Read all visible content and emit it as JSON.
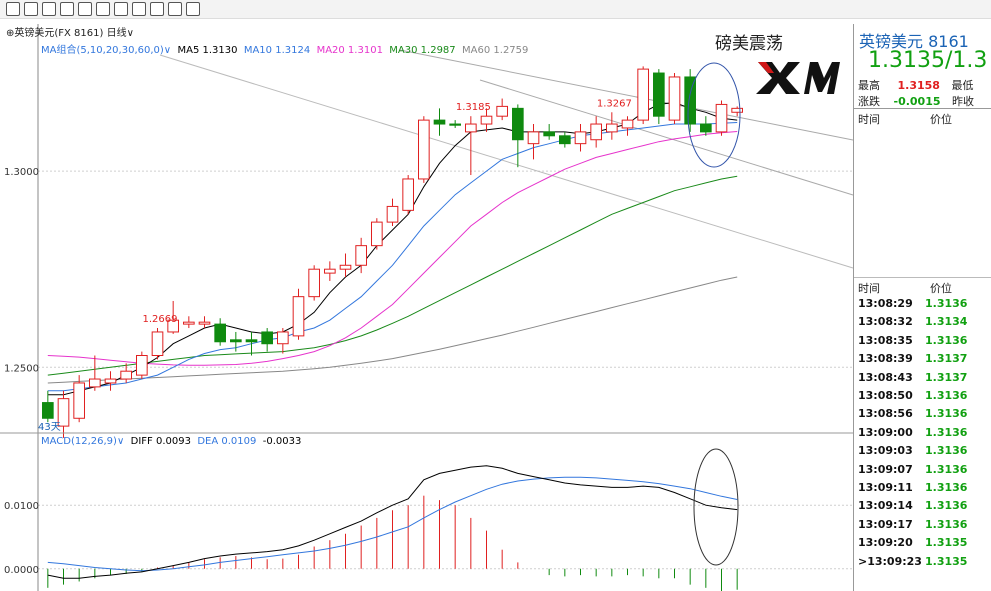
{
  "header": {
    "symbol_line": "⊕英镑美元(FX 8161)  日线∨",
    "title": "磅美震荡",
    "logo_text": "XM"
  },
  "indicators": {
    "ma_label": "MA组合(5,10,20,30,60,0)∨",
    "ma5": "MA5 1.3130",
    "ma10": "MA10 1.3124",
    "ma20": "MA20 1.3101",
    "ma30": "MA30 1.2987",
    "ma60": "MA60 1.2759",
    "macd_label": "MACD(12,26,9)∨",
    "diff": "DIFF 0.0093",
    "dea": "DEA 0.0109",
    "macd_val": "-0.0033"
  },
  "colors": {
    "up": "#e02020",
    "down": "#0f8a0f",
    "ma5": "#000000",
    "ma10": "#3377dd",
    "ma20": "#e633cc",
    "ma30": "#1a8a1a",
    "ma60": "#888888",
    "diff": "#000000",
    "dea": "#3377dd",
    "annotation": "#3355aa",
    "channel": "#aaaaaa"
  },
  "quote_panel": {
    "name": "英镑美元  8161",
    "price": "1.3135/1.3",
    "high_label": "最高",
    "high_value": "1.3158",
    "low_label": "最低",
    "change_label": "涨跌",
    "change_value": "-0.0015",
    "prev_label": "昨收",
    "time_header": "时间",
    "price_header": "价位",
    "time_header2": "时间",
    "price_header2": "价位",
    "ticks": [
      {
        "time": "13:08:29",
        "price": "1.3136"
      },
      {
        "time": "13:08:32",
        "price": "1.3134"
      },
      {
        "time": "13:08:35",
        "price": "1.3136"
      },
      {
        "time": "13:08:39",
        "price": "1.3137"
      },
      {
        "time": "13:08:43",
        "price": "1.3137"
      },
      {
        "time": "13:08:50",
        "price": "1.3136"
      },
      {
        "time": "13:08:56",
        "price": "1.3136"
      },
      {
        "time": "13:09:00",
        "price": "1.3136"
      },
      {
        "time": "13:09:03",
        "price": "1.3136"
      },
      {
        "time": "13:09:07",
        "price": "1.3136"
      },
      {
        "time": "13:09:11",
        "price": "1.3136"
      },
      {
        "time": "13:09:14",
        "price": "1.3136"
      },
      {
        "time": "13:09:17",
        "price": "1.3136"
      },
      {
        "time": "13:09:20",
        "price": "1.3135"
      },
      {
        "time": ">13:09:23",
        "price": "1.3135"
      }
    ]
  },
  "chart_data": {
    "type": "candlestick",
    "price_axis": {
      "ylim": [
        1.2335,
        1.3375
      ],
      "ticks": [
        1.25,
        1.3
      ],
      "tick_labels": [
        "1.2500",
        "1.3000"
      ]
    },
    "macd_axis": {
      "ylim": [
        -0.0035,
        0.019
      ],
      "ticks": [
        0.0,
        0.01
      ],
      "tick_labels": [
        "0.0000",
        "0.0100"
      ]
    },
    "annotations": [
      {
        "label": "1.2669",
        "index": 7,
        "price": 1.2669
      },
      {
        "label": "1.3185",
        "index": 27,
        "price": 1.3185
      },
      {
        "label": "1.3267",
        "index": 36,
        "price": 1.3267
      }
    ],
    "period_label": "43天",
    "candles": [
      {
        "o": 1.241,
        "h": 1.244,
        "l": 1.236,
        "c": 1.237
      },
      {
        "o": 1.235,
        "h": 1.244,
        "l": 1.232,
        "c": 1.242
      },
      {
        "o": 1.237,
        "h": 1.248,
        "l": 1.236,
        "c": 1.246
      },
      {
        "o": 1.245,
        "h": 1.253,
        "l": 1.244,
        "c": 1.247
      },
      {
        "o": 1.246,
        "h": 1.249,
        "l": 1.244,
        "c": 1.247
      },
      {
        "o": 1.247,
        "h": 1.251,
        "l": 1.246,
        "c": 1.249
      },
      {
        "o": 1.248,
        "h": 1.254,
        "l": 1.247,
        "c": 1.253
      },
      {
        "o": 1.253,
        "h": 1.26,
        "l": 1.252,
        "c": 1.259
      },
      {
        "o": 1.259,
        "h": 1.2669,
        "l": 1.2585,
        "c": 1.262
      },
      {
        "o": 1.261,
        "h": 1.263,
        "l": 1.26,
        "c": 1.2615
      },
      {
        "o": 1.261,
        "h": 1.263,
        "l": 1.26,
        "c": 1.2615
      },
      {
        "o": 1.261,
        "h": 1.2625,
        "l": 1.2555,
        "c": 1.2565
      },
      {
        "o": 1.257,
        "h": 1.259,
        "l": 1.254,
        "c": 1.2565
      },
      {
        "o": 1.257,
        "h": 1.259,
        "l": 1.253,
        "c": 1.2565
      },
      {
        "o": 1.259,
        "h": 1.26,
        "l": 1.254,
        "c": 1.256
      },
      {
        "o": 1.256,
        "h": 1.26,
        "l": 1.2535,
        "c": 1.259
      },
      {
        "o": 1.258,
        "h": 1.27,
        "l": 1.257,
        "c": 1.268
      },
      {
        "o": 1.268,
        "h": 1.276,
        "l": 1.267,
        "c": 1.275
      },
      {
        "o": 1.274,
        "h": 1.277,
        "l": 1.272,
        "c": 1.275
      },
      {
        "o": 1.275,
        "h": 1.279,
        "l": 1.273,
        "c": 1.276
      },
      {
        "o": 1.276,
        "h": 1.283,
        "l": 1.274,
        "c": 1.281
      },
      {
        "o": 1.281,
        "h": 1.288,
        "l": 1.28,
        "c": 1.287
      },
      {
        "o": 1.287,
        "h": 1.293,
        "l": 1.286,
        "c": 1.291
      },
      {
        "o": 1.29,
        "h": 1.299,
        "l": 1.289,
        "c": 1.298
      },
      {
        "o": 1.298,
        "h": 1.314,
        "l": 1.297,
        "c": 1.313
      },
      {
        "o": 1.313,
        "h": 1.316,
        "l": 1.309,
        "c": 1.312
      },
      {
        "o": 1.312,
        "h": 1.313,
        "l": 1.311,
        "c": 1.3117
      },
      {
        "o": 1.31,
        "h": 1.314,
        "l": 1.299,
        "c": 1.312
      },
      {
        "o": 1.312,
        "h": 1.316,
        "l": 1.31,
        "c": 1.314
      },
      {
        "o": 1.314,
        "h": 1.3185,
        "l": 1.313,
        "c": 1.3165
      },
      {
        "o": 1.316,
        "h": 1.317,
        "l": 1.301,
        "c": 1.308
      },
      {
        "o": 1.307,
        "h": 1.312,
        "l": 1.303,
        "c": 1.31
      },
      {
        "o": 1.31,
        "h": 1.312,
        "l": 1.308,
        "c": 1.309
      },
      {
        "o": 1.309,
        "h": 1.31,
        "l": 1.306,
        "c": 1.307
      },
      {
        "o": 1.307,
        "h": 1.312,
        "l": 1.305,
        "c": 1.31
      },
      {
        "o": 1.308,
        "h": 1.314,
        "l": 1.306,
        "c": 1.312
      },
      {
        "o": 1.31,
        "h": 1.315,
        "l": 1.308,
        "c": 1.312
      },
      {
        "o": 1.311,
        "h": 1.314,
        "l": 1.309,
        "c": 1.313
      },
      {
        "o": 1.313,
        "h": 1.3267,
        "l": 1.312,
        "c": 1.326
      },
      {
        "o": 1.325,
        "h": 1.326,
        "l": 1.312,
        "c": 1.314
      },
      {
        "o": 1.313,
        "h": 1.325,
        "l": 1.312,
        "c": 1.324
      },
      {
        "o": 1.324,
        "h": 1.326,
        "l": 1.31,
        "c": 1.312
      },
      {
        "o": 1.312,
        "h": 1.314,
        "l": 1.309,
        "c": 1.31
      },
      {
        "o": 1.31,
        "h": 1.318,
        "l": 1.309,
        "c": 1.317
      },
      {
        "o": 1.315,
        "h": 1.3165,
        "l": 1.314,
        "c": 1.316
      }
    ],
    "ma5": [
      1.243,
      1.243,
      1.244,
      1.245,
      1.246,
      1.248,
      1.25,
      1.2525,
      1.256,
      1.258,
      1.26,
      1.261,
      1.26,
      1.259,
      1.2585,
      1.259,
      1.261,
      1.264,
      1.269,
      1.273,
      1.276,
      1.281,
      1.285,
      1.289,
      1.296,
      1.302,
      1.3065,
      1.31,
      1.3105,
      1.311,
      1.31,
      1.31,
      1.31,
      1.31,
      1.3095,
      1.31,
      1.311,
      1.312,
      1.315,
      1.317,
      1.3175,
      1.316,
      1.315,
      1.3135,
      1.313
    ],
    "ma10": [
      1.244,
      1.244,
      1.2445,
      1.245,
      1.2455,
      1.246,
      1.247,
      1.248,
      1.25,
      1.252,
      1.2535,
      1.2545,
      1.255,
      1.256,
      1.257,
      1.2575,
      1.259,
      1.26,
      1.262,
      1.265,
      1.268,
      1.272,
      1.276,
      1.281,
      1.286,
      1.29,
      1.294,
      1.297,
      1.3,
      1.303,
      1.3045,
      1.306,
      1.307,
      1.308,
      1.309,
      1.3095,
      1.31,
      1.3105,
      1.311,
      1.3115,
      1.312,
      1.312,
      1.312,
      1.3122,
      1.3124
    ],
    "ma20": [
      1.253,
      1.2528,
      1.2526,
      1.2522,
      1.2518,
      1.2514,
      1.251,
      1.2508,
      1.2506,
      1.2505,
      1.2505,
      1.2506,
      1.2507,
      1.251,
      1.2515,
      1.2522,
      1.253,
      1.254,
      1.2555,
      1.2575,
      1.26,
      1.263,
      1.266,
      1.27,
      1.274,
      1.278,
      1.282,
      1.286,
      1.289,
      1.292,
      1.2945,
      1.2965,
      1.2985,
      1.3005,
      1.302,
      1.3035,
      1.3045,
      1.3055,
      1.3065,
      1.3075,
      1.3082,
      1.3088,
      1.3094,
      1.3098,
      1.3101
    ],
    "ma30": [
      1.248,
      1.2485,
      1.249,
      1.2495,
      1.25,
      1.2505,
      1.251,
      1.2515,
      1.252,
      1.2525,
      1.253,
      1.2532,
      1.2534,
      1.2536,
      1.2538,
      1.254,
      1.2545,
      1.255,
      1.2558,
      1.2568,
      1.258,
      1.2595,
      1.2612,
      1.263,
      1.265,
      1.267,
      1.269,
      1.271,
      1.273,
      1.275,
      1.277,
      1.279,
      1.281,
      1.283,
      1.285,
      1.287,
      1.289,
      1.2905,
      1.292,
      1.2935,
      1.295,
      1.296,
      1.297,
      1.298,
      1.2987
    ],
    "ma60": [
      1.246,
      1.2462,
      1.2464,
      1.2466,
      1.2468,
      1.247,
      1.2472,
      1.2474,
      1.2476,
      1.2478,
      1.248,
      1.2482,
      1.2484,
      1.2486,
      1.2488,
      1.249,
      1.2493,
      1.2496,
      1.25,
      1.2505,
      1.251,
      1.2516,
      1.2522,
      1.253,
      1.2538,
      1.2546,
      1.2555,
      1.2564,
      1.2573,
      1.2582,
      1.2592,
      1.2602,
      1.2612,
      1.2622,
      1.2632,
      1.2642,
      1.2652,
      1.2662,
      1.2672,
      1.2682,
      1.2692,
      1.2702,
      1.2712,
      1.2722,
      1.273
    ],
    "macd_hist": [
      -0.003,
      -0.0025,
      -0.002,
      -0.0015,
      -0.001,
      -0.0008,
      -0.0005,
      0.0002,
      0.0005,
      0.001,
      0.0015,
      0.0018,
      0.002,
      0.0018,
      0.0015,
      0.0016,
      0.0022,
      0.0035,
      0.0045,
      0.0055,
      0.0068,
      0.008,
      0.0092,
      0.01,
      0.0115,
      0.0108,
      0.01,
      0.008,
      0.006,
      0.003,
      0.001,
      0.0,
      -0.001,
      -0.0012,
      -0.001,
      -0.0012,
      -0.0012,
      -0.001,
      -0.0012,
      -0.0015,
      -0.0015,
      -0.0025,
      -0.003,
      -0.0035,
      -0.0033
    ],
    "diff": [
      -0.001,
      -0.0015,
      -0.0015,
      -0.0012,
      -0.001,
      -0.0007,
      -0.0005,
      0.0,
      0.0005,
      0.001,
      0.0016,
      0.002,
      0.0023,
      0.0025,
      0.0027,
      0.003,
      0.0036,
      0.0045,
      0.0055,
      0.0065,
      0.0075,
      0.0088,
      0.01,
      0.011,
      0.014,
      0.015,
      0.0155,
      0.016,
      0.0162,
      0.0158,
      0.015,
      0.0145,
      0.014,
      0.0135,
      0.0132,
      0.013,
      0.0128,
      0.0128,
      0.013,
      0.0128,
      0.012,
      0.011,
      0.01,
      0.0096,
      0.0093
    ],
    "dea": [
      0.001,
      0.0008,
      0.0005,
      0.0002,
      0.0,
      -0.0002,
      -0.0003,
      -0.0002,
      0.0,
      0.0003,
      0.0006,
      0.001,
      0.0013,
      0.0016,
      0.0019,
      0.0022,
      0.0025,
      0.0028,
      0.0032,
      0.0037,
      0.0043,
      0.005,
      0.0058,
      0.0066,
      0.008,
      0.0093,
      0.0105,
      0.0115,
      0.0125,
      0.0133,
      0.0138,
      0.0141,
      0.0143,
      0.0144,
      0.0144,
      0.0143,
      0.0141,
      0.0139,
      0.0137,
      0.0134,
      0.013,
      0.0126,
      0.012,
      0.0114,
      0.0109
    ]
  }
}
